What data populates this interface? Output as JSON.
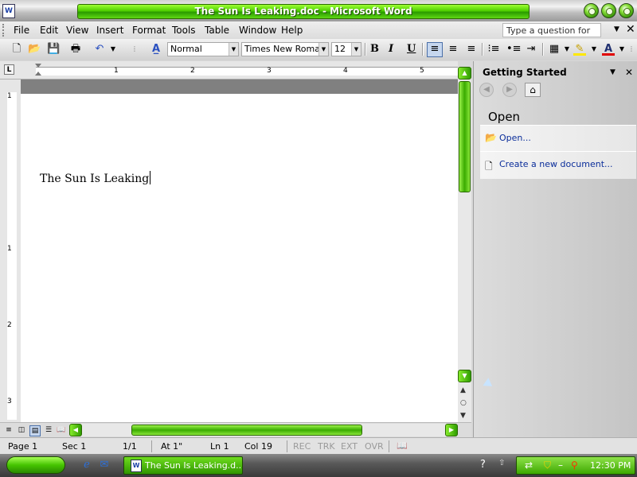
{
  "window": {
    "title": "The Sun Is Leaking.doc - Microsoft Word"
  },
  "menubar": {
    "items": [
      "File",
      "Edit",
      "View",
      "Insert",
      "Format",
      "Tools",
      "Table",
      "Window",
      "Help"
    ],
    "help_box": {
      "placeholder": "Type a question for help"
    }
  },
  "toolbar": {
    "style": "Normal",
    "font": "Times New Roman",
    "size": "12",
    "bold_label": "B",
    "italic_label": "I",
    "underline_label": "U",
    "align_left_active": true
  },
  "ruler": {
    "numbers": [
      "1",
      "2",
      "3",
      "4",
      "5"
    ],
    "vertical_numbers": [
      "1",
      "1",
      "2",
      "3"
    ]
  },
  "document": {
    "text": "The Sun Is Leaking"
  },
  "taskpane": {
    "title": "Getting Started",
    "heading": "Open",
    "links": [
      "Open...",
      "Create a new document..."
    ]
  },
  "statusbar": {
    "page": "Page 1",
    "section": "Sec 1",
    "page_count": "1/1",
    "at": "At 1\"",
    "line": "Ln 1",
    "col": "Col 19",
    "modes": [
      "REC",
      "TRK",
      "EXT",
      "OVR"
    ]
  },
  "taskbar": {
    "active_task": "The Sun Is Leaking.d...",
    "clock": "12:30 PM"
  },
  "colors": {
    "accent_green": "#4fcf00",
    "link_blue": "#0a2d9a"
  }
}
